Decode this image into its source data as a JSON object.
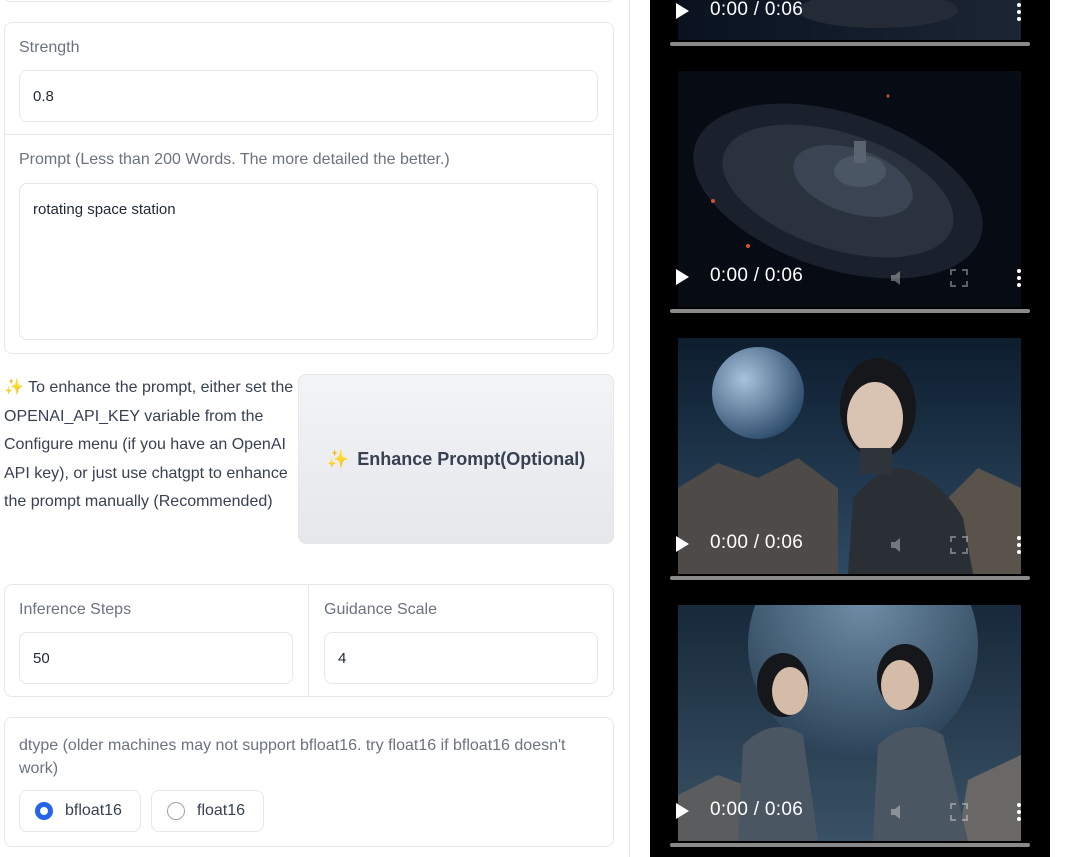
{
  "strength": {
    "label": "Strength",
    "value": "0.8"
  },
  "prompt": {
    "label": "Prompt (Less than 200 Words. The more detailed the better.)",
    "value": "rotating space station"
  },
  "enhance": {
    "icon": "sparkles-icon",
    "hint_icon": "✨",
    "hint": "To enhance the prompt, either set the OPENAI_API_KEY variable from the Configure menu (if you have an OpenAI API key), or just use chatgpt to enhance the prompt manually (Recommended)",
    "button_icon": "✨",
    "button_label": "Enhance Prompt(Optional)"
  },
  "inference_steps": {
    "label": "Inference Steps",
    "value": "50"
  },
  "guidance_scale": {
    "label": "Guidance Scale",
    "value": "4"
  },
  "dtype": {
    "label": "dtype (older machines may not support bfloat16. try float16 if bfloat16 doesn't work)",
    "options": [
      {
        "label": "bfloat16",
        "selected": true
      },
      {
        "label": "float16",
        "selected": false
      }
    ]
  },
  "videos": [
    {
      "time": "0:00 / 0:06",
      "progress": 0,
      "subject": "space station (partially scrolled)"
    },
    {
      "time": "0:00 / 0:06",
      "progress": 0,
      "subject": "rotating space station near planet"
    },
    {
      "time": "0:00 / 0:06",
      "progress": 0,
      "subject": "woman in armored suit with planet"
    },
    {
      "time": "0:00 / 0:06",
      "progress": 0,
      "subject": "two women in armored suits with planet"
    }
  ],
  "colors": {
    "accent": "#2563eb",
    "border": "#e5e7eb",
    "video_bg": "#000000"
  }
}
